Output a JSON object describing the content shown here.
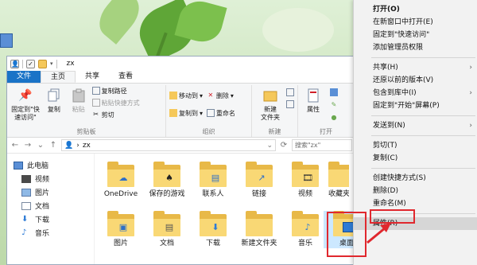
{
  "window": {
    "title": "zx",
    "tabs": {
      "file": "文件",
      "home": "主页",
      "share": "共享",
      "view": "查看"
    }
  },
  "ribbon": {
    "clipboard": {
      "pin": "固定到\"快速访问\"",
      "copy": "复制",
      "paste": "粘贴",
      "copy_path": "复制路径",
      "paste_shortcut": "粘贴快捷方式",
      "cut": "剪切",
      "label": "剪贴板"
    },
    "organize": {
      "move_to": "移动到",
      "copy_to": "复制到",
      "delete": "删除",
      "rename": "重命名",
      "label": "组织"
    },
    "new": {
      "new_folder": "新建\n文件夹",
      "label": "新建"
    },
    "open": {
      "properties": "属性",
      "label": "打开"
    }
  },
  "address": {
    "path": "zx",
    "search_placeholder": "搜索\"zx\""
  },
  "nav_pane": {
    "items": [
      {
        "label": "此电脑",
        "icon": "computer-icon"
      },
      {
        "label": "视频",
        "icon": "video-icon"
      },
      {
        "label": "图片",
        "icon": "pictures-icon"
      },
      {
        "label": "文档",
        "icon": "documents-icon"
      },
      {
        "label": "下载",
        "icon": "download-icon"
      },
      {
        "label": "音乐",
        "icon": "music-icon"
      }
    ]
  },
  "files": {
    "row1": [
      "OneDrive",
      "保存的游戏",
      "联系人",
      "链接",
      "视频",
      "收藏夹"
    ],
    "row2": [
      "图片",
      "文档",
      "下载",
      "新建文件夹",
      "音乐",
      "桌面"
    ]
  },
  "context_menu": {
    "items": [
      {
        "label": "打开(O)",
        "bold": true
      },
      {
        "label": "在新窗口中打开(E)"
      },
      {
        "label": "固定到\"快速访问\""
      },
      {
        "label": "添加管理员权限"
      },
      {
        "sep": true
      },
      {
        "label": "共享(H)",
        "sub": true
      },
      {
        "label": "还原以前的版本(V)"
      },
      {
        "label": "包含到库中(I)",
        "sub": true
      },
      {
        "label": "固定到\"开始\"屏幕(P)"
      },
      {
        "sep": true
      },
      {
        "label": "发送到(N)",
        "sub": true
      },
      {
        "sep": true
      },
      {
        "label": "剪切(T)"
      },
      {
        "label": "复制(C)"
      },
      {
        "sep": true
      },
      {
        "label": "创建快捷方式(S)"
      },
      {
        "label": "删除(D)"
      },
      {
        "label": "重命名(M)"
      },
      {
        "sep": true
      },
      {
        "label": "属性(R)",
        "highlight": true
      }
    ]
  },
  "colors": {
    "accent": "#1a73c7",
    "annotation": "#e0282e",
    "folder": "#f9d875"
  }
}
